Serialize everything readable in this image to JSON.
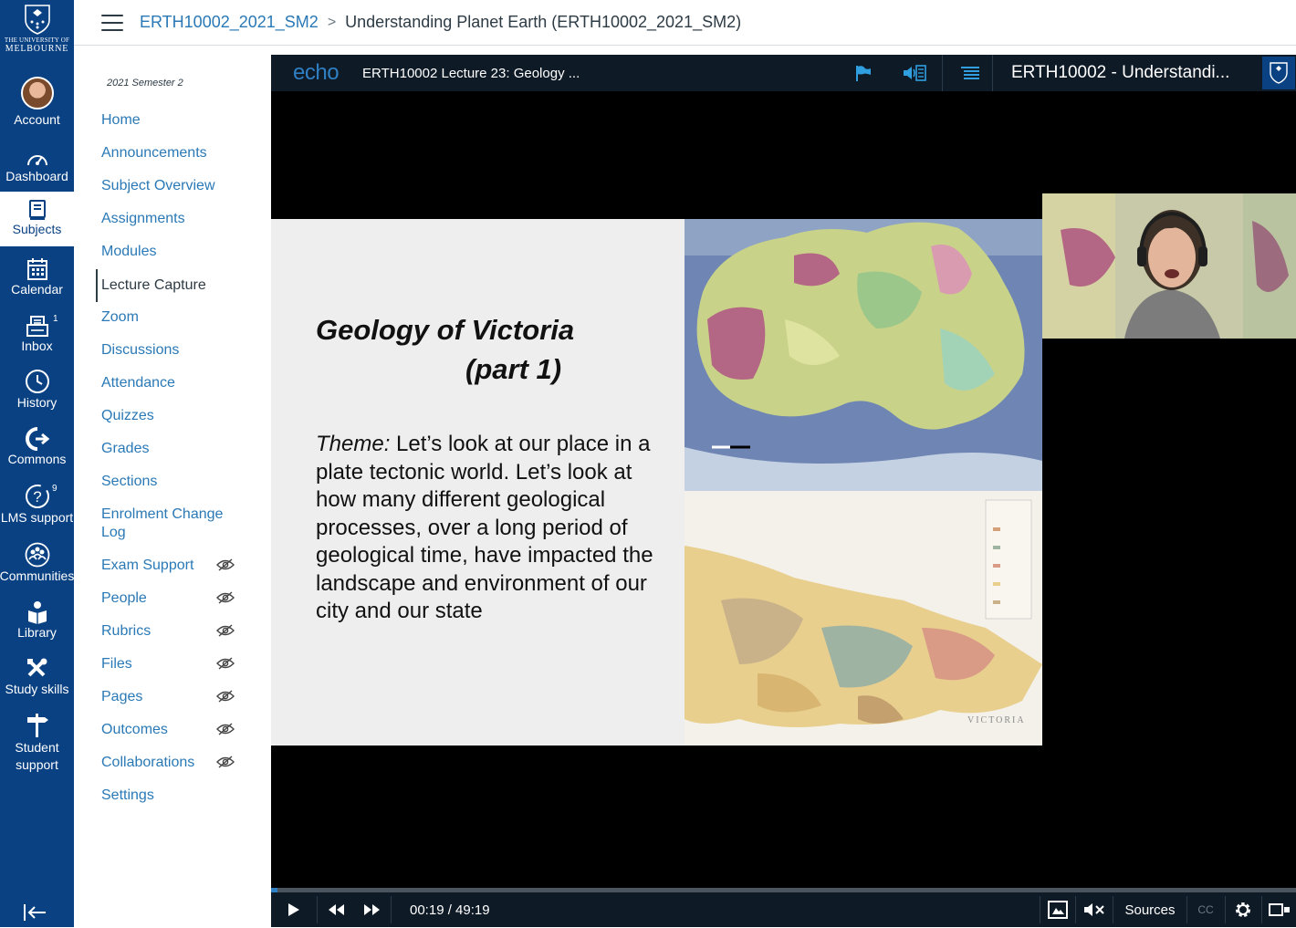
{
  "global_nav": {
    "logo": {
      "line1": "THE UNIVERSITY OF",
      "line2": "MELBOURNE"
    },
    "items": [
      {
        "label": "Account"
      },
      {
        "label": "Dashboard"
      },
      {
        "label": "Subjects"
      },
      {
        "label": "Calendar"
      },
      {
        "label": "Inbox",
        "badge": "1"
      },
      {
        "label": "History"
      },
      {
        "label": "Commons"
      },
      {
        "label": "LMS support",
        "badge": "9"
      },
      {
        "label": "Communities"
      },
      {
        "label": "Library"
      },
      {
        "label": "Study skills"
      },
      {
        "label": "Student support"
      }
    ],
    "active": "Subjects",
    "brand_color": "#094183"
  },
  "breadcrumb": {
    "link": "ERTH10002_2021_SM2",
    "separator": ">",
    "current": "Understanding Planet Earth (ERTH10002_2021_SM2)"
  },
  "subject_nav": {
    "term": "2021 Semester 2",
    "items": [
      {
        "label": "Home"
      },
      {
        "label": "Announcements"
      },
      {
        "label": "Subject Overview"
      },
      {
        "label": "Assignments"
      },
      {
        "label": "Modules"
      },
      {
        "label": "Lecture Capture",
        "active": true
      },
      {
        "label": "Zoom"
      },
      {
        "label": "Discussions"
      },
      {
        "label": "Attendance"
      },
      {
        "label": "Quizzes"
      },
      {
        "label": "Grades"
      },
      {
        "label": "Sections"
      },
      {
        "label": "Enrolment Change Log"
      },
      {
        "label": "Exam Support",
        "hidden_from_students": true
      },
      {
        "label": "People",
        "hidden_from_students": true
      },
      {
        "label": "Rubrics",
        "hidden_from_students": true
      },
      {
        "label": "Files",
        "hidden_from_students": true
      },
      {
        "label": "Pages",
        "hidden_from_students": true
      },
      {
        "label": "Outcomes",
        "hidden_from_students": true
      },
      {
        "label": "Collaborations",
        "hidden_from_students": true
      },
      {
        "label": "Settings"
      }
    ]
  },
  "player": {
    "logo": "echo",
    "lecture_title": "ERTH10002 Lecture 23: Geology ...",
    "course_title": "ERTH10002 - Understandi...",
    "header_icons": [
      "flag-icon",
      "audio-description-icon",
      "list-icon"
    ],
    "slide": {
      "title": "Geology of Victoria",
      "subtitle": "(part 1)",
      "theme_label": "Theme:",
      "theme_text": " Let’s look at our place in a plate tectonic world. Let’s look at how many different geological processes, over a long period of geological time, have impacted the landscape and environment of our city and our state",
      "map_caption": "VICTORIA"
    },
    "controls": {
      "current_time": "00:19",
      "duration": "49:19",
      "time_text": "00:19 / 49:19",
      "progress_fraction": 0.0064,
      "sources_label": "Sources",
      "cc_label": "CC",
      "accent": "#2f7fc4"
    }
  }
}
